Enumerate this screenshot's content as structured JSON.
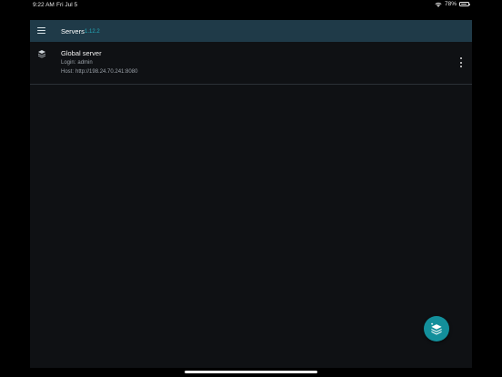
{
  "status_bar": {
    "time": "9:22 AM",
    "date": "Fri Jul 5",
    "battery": "78%",
    "battery_level": 0.78
  },
  "app_bar": {
    "title": "Servers",
    "version": "1.12.2",
    "menu_icon": "hamburger-menu-icon"
  },
  "servers": [
    {
      "name": "Global server",
      "login_label": "Login:",
      "login": "admin",
      "host_label": "Host:",
      "host": "http://198.24.70.241:8080",
      "icon": "layers-stack-icon",
      "more_icon": "more-vertical-icon"
    }
  ],
  "fab": {
    "icon": "add-server-stack-icon"
  },
  "colors": {
    "app_bar_bg": "#1f3a48",
    "app_bg": "#0f1114",
    "accent": "#23a8b8",
    "fab_bg": "#138f9b"
  }
}
